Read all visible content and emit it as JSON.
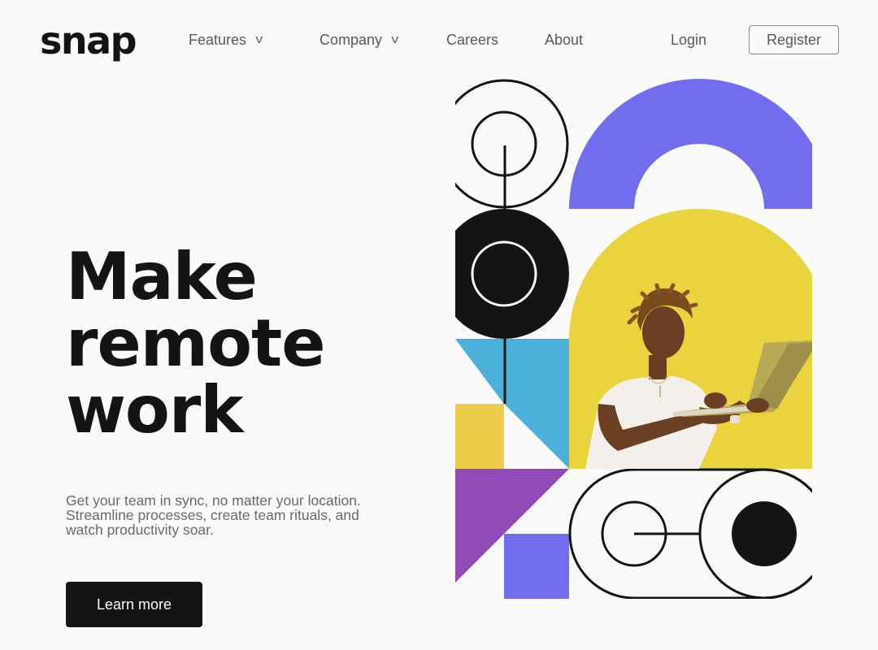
{
  "header": {
    "logo": "snap",
    "nav": [
      {
        "label": "Features",
        "dropdown": true
      },
      {
        "label": "Company",
        "dropdown": true
      },
      {
        "label": "Careers",
        "dropdown": false
      },
      {
        "label": "About",
        "dropdown": false
      }
    ],
    "chevron": "v",
    "login_label": "Login",
    "register_label": "Register"
  },
  "hero": {
    "title_lines": [
      "Make",
      "remote",
      "work"
    ],
    "description": "Get your team in sync, no matter your location. Streamline processes, create team rituals, and watch productivity soar.",
    "cta_label": "Learn more"
  },
  "colors": {
    "text_dark": "#141414",
    "text_gray": "#696969",
    "purple": "#726cee",
    "yellow": "#e8d340",
    "blue": "#4bb1da",
    "violet": "#904bb9",
    "background": "#fafafa"
  },
  "icons": [
    "chevron-down-icon",
    "chevron-down-icon"
  ]
}
